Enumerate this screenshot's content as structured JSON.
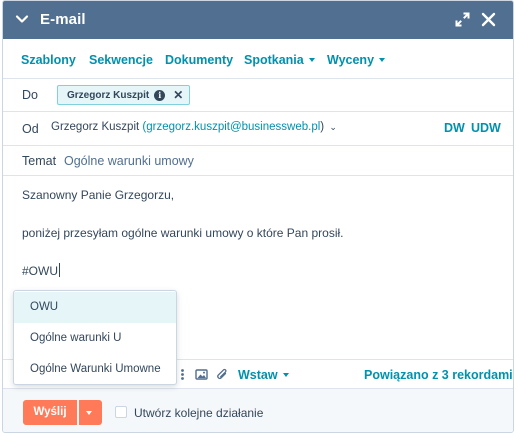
{
  "header": {
    "title": "E-mail"
  },
  "menu": [
    {
      "label": "Szablony",
      "caret": false
    },
    {
      "label": "Sekwencje",
      "caret": false
    },
    {
      "label": "Dokumenty",
      "caret": false
    },
    {
      "label": "Spotkania",
      "caret": true
    },
    {
      "label": "Wyceny",
      "caret": true
    }
  ],
  "to": {
    "label": "Do",
    "recipient": "Grzegorz Kuszpit"
  },
  "from": {
    "label": "Od",
    "name": "Grzegorz Kuszpit",
    "email": "(grzegorz.kuszpit@businessweb.pl",
    "suffix": ")",
    "dw": "DW",
    "udw": "UDW"
  },
  "subject": {
    "label": "Temat",
    "value": "Ogólne warunki umowy"
  },
  "body": {
    "greeting": "Szanowny Panie Grzegorzu,",
    "line": "poniżej przesyłam ogólne warunki umowy o które Pan prosił.",
    "typed": "#OWU"
  },
  "suggestions": [
    {
      "label": "OWU",
      "active": true
    },
    {
      "label": "Ogólne warunki U",
      "active": false
    },
    {
      "label": "Ogólne Warunki Umowne",
      "active": false
    }
  ],
  "toolbar": {
    "insert": "Wstaw",
    "associated": "Powiązano z 3 rekordami"
  },
  "footer": {
    "send": "Wyślij",
    "followup": "Utwórz kolejne działanie"
  },
  "colors": {
    "header": "#516f90",
    "link": "#0091ae",
    "send": "#ff7a59",
    "highlight": "#e5f5f8"
  }
}
